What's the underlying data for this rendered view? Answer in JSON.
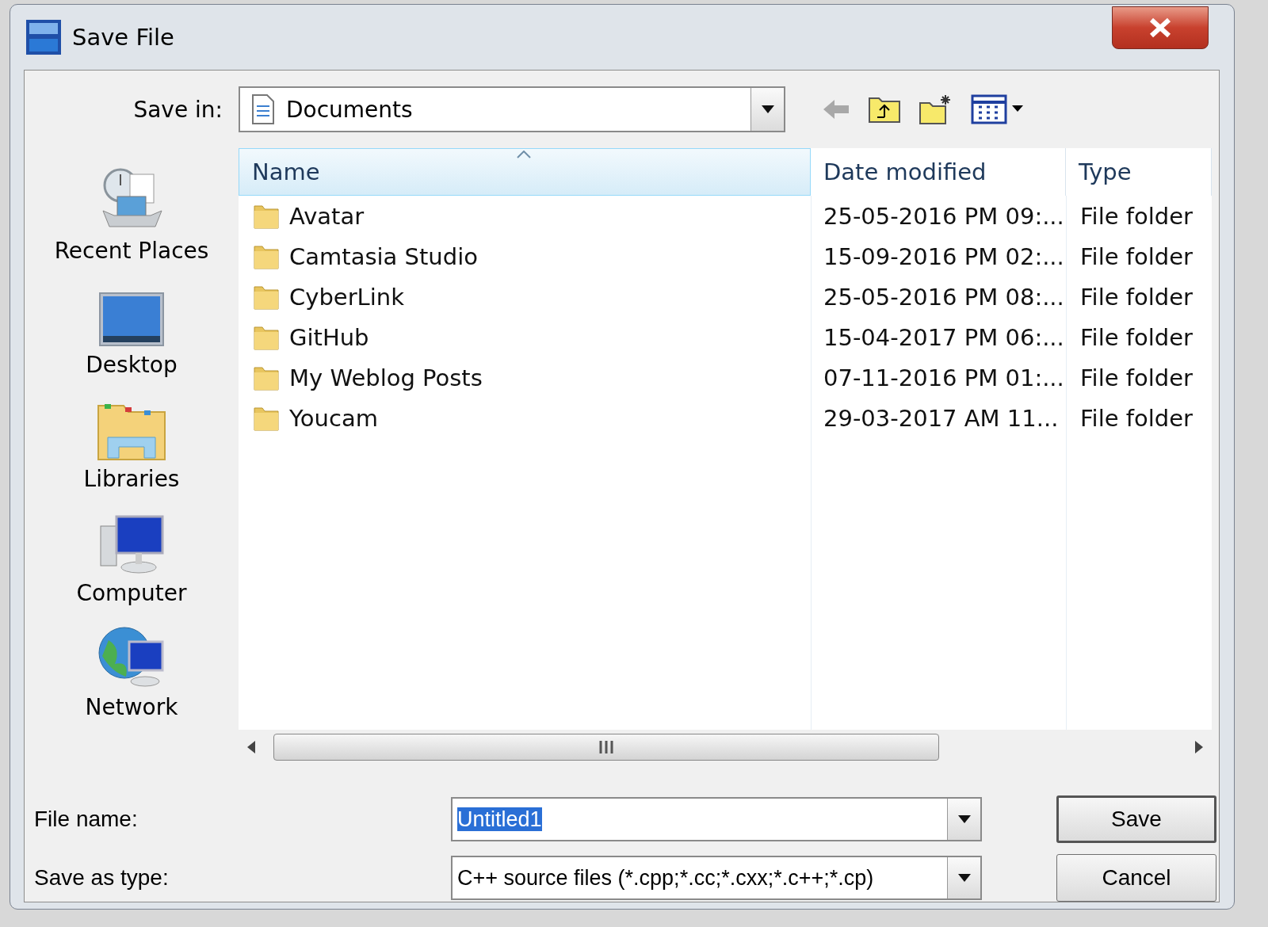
{
  "window": {
    "title": "Save File"
  },
  "save_in": {
    "label": "Save in:",
    "value": "Documents"
  },
  "places": [
    {
      "label": "Recent Places",
      "kind": "recent"
    },
    {
      "label": "Desktop",
      "kind": "desktop"
    },
    {
      "label": "Libraries",
      "kind": "libraries"
    },
    {
      "label": "Computer",
      "kind": "computer"
    },
    {
      "label": "Network",
      "kind": "network"
    }
  ],
  "file_list": {
    "columns": [
      {
        "label": "Name",
        "sorted": true
      },
      {
        "label": "Date modified",
        "sorted": false
      },
      {
        "label": "Type",
        "sorted": false
      }
    ],
    "rows": [
      {
        "name": "Avatar",
        "date_modified": "25-05-2016 PM 09:...",
        "type": "File folder"
      },
      {
        "name": "Camtasia Studio",
        "date_modified": "15-09-2016 PM 02:...",
        "type": "File folder"
      },
      {
        "name": "CyberLink",
        "date_modified": "25-05-2016 PM 08:...",
        "type": "File folder"
      },
      {
        "name": "GitHub",
        "date_modified": "15-04-2017 PM 06:...",
        "type": "File folder"
      },
      {
        "name": "My Weblog Posts",
        "date_modified": "07-11-2016 PM 01:...",
        "type": "File folder"
      },
      {
        "name": "Youcam",
        "date_modified": "29-03-2017 AM 11...",
        "type": "File folder"
      }
    ]
  },
  "file_name": {
    "label": "File name:",
    "value": "Untitled1",
    "text_selected": true
  },
  "save_as_type": {
    "label": "Save as type:",
    "value": "C++ source files (*.cpp;*.cc;*.cxx;*.c++;*.cp)"
  },
  "buttons": [
    {
      "label": "Save",
      "default": true
    },
    {
      "label": "Cancel",
      "default": false
    }
  ]
}
